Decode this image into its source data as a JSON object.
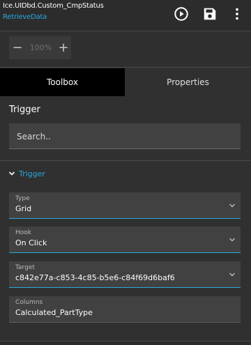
{
  "header": {
    "title": "Ice.UIDbd.Custom_CmpStatus",
    "subtitle": "RetrieveData",
    "actions": [
      "play-circle-icon",
      "save-icon",
      "more-vert-icon"
    ]
  },
  "zoom": {
    "minus": "−",
    "value": "100%",
    "plus": "+"
  },
  "tabs": [
    {
      "label": "Toolbox",
      "active": true
    },
    {
      "label": "Properties",
      "active": false
    }
  ],
  "toolbox": {
    "section_title": "Trigger",
    "search_placeholder": "Search..",
    "group": {
      "label": "Trigger",
      "expanded": true,
      "fields": [
        {
          "label": "Type",
          "value": "Grid"
        },
        {
          "label": "Hook",
          "value": "On Click"
        },
        {
          "label": "Target",
          "value": "c842e77a-c853-4c85-b5e6-c84f69d6baf6"
        },
        {
          "label": "Columns",
          "value": "Calculated_PartType"
        }
      ]
    }
  },
  "colors": {
    "accent": "#29a9e0",
    "background": "#303030",
    "tab_active": "#000000",
    "field_bg": "#414141"
  }
}
